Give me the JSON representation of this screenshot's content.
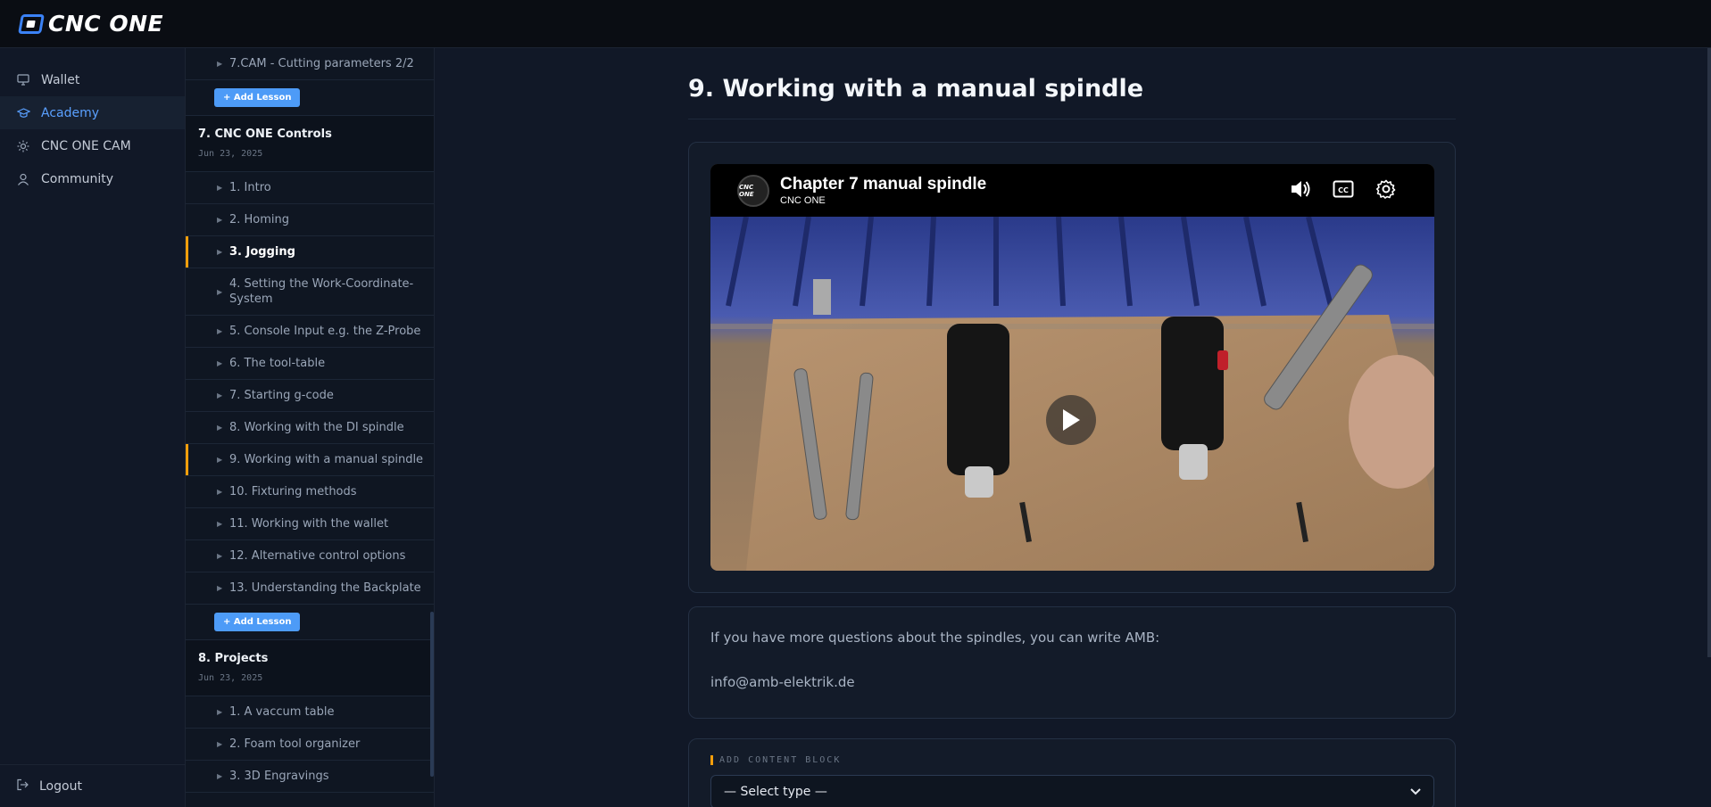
{
  "brand": {
    "name": "CNC ONE"
  },
  "nav": {
    "items": [
      {
        "label": "Wallet",
        "icon": "monitor-icon"
      },
      {
        "label": "Academy",
        "icon": "graduation-icon"
      },
      {
        "label": "CNC ONE CAM",
        "icon": "sun-icon"
      },
      {
        "label": "Community",
        "icon": "person-icon"
      }
    ],
    "logout": "Logout"
  },
  "lessons": {
    "top_item": "7.CAM - Cutting parameters 2/2",
    "add_label": "+ Add Lesson",
    "section7": {
      "title": "7. CNC ONE Controls",
      "date": "Jun 23, 2025",
      "items": [
        "1. Intro",
        "2. Homing",
        "3. Jogging",
        "4. Setting the Work-Coordinate-System",
        "5. Console Input e.g. the Z-Probe",
        "6. The tool-table",
        "7. Starting g-code",
        "8. Working with the DI spindle",
        "9. Working with a manual spindle",
        "10. Fixturing methods",
        "11. Working with the wallet",
        "12. Alternative control options",
        "13. Understanding the Backplate"
      ]
    },
    "section8": {
      "title": "8. Projects",
      "date": "Jun 23, 2025",
      "items": [
        "1. A vaccum table",
        "2. Foam tool organizer",
        "3. 3D Engravings"
      ]
    }
  },
  "main": {
    "title": "9. Working with a manual spindle",
    "video": {
      "title": "Chapter 7 manual spindle",
      "channel": "CNC ONE",
      "avatar_text": "CNC ONE"
    },
    "info": {
      "line1": "If you have more questions about the spindles, you can write AMB:",
      "line2": "info@amb-elektrik.de"
    },
    "add_block": {
      "label": "ADD CONTENT BLOCK",
      "select_value": "— Select type —"
    }
  },
  "colors": {
    "accent": "#4d9bf7",
    "highlight": "#f59e0b",
    "background": "#111827"
  }
}
